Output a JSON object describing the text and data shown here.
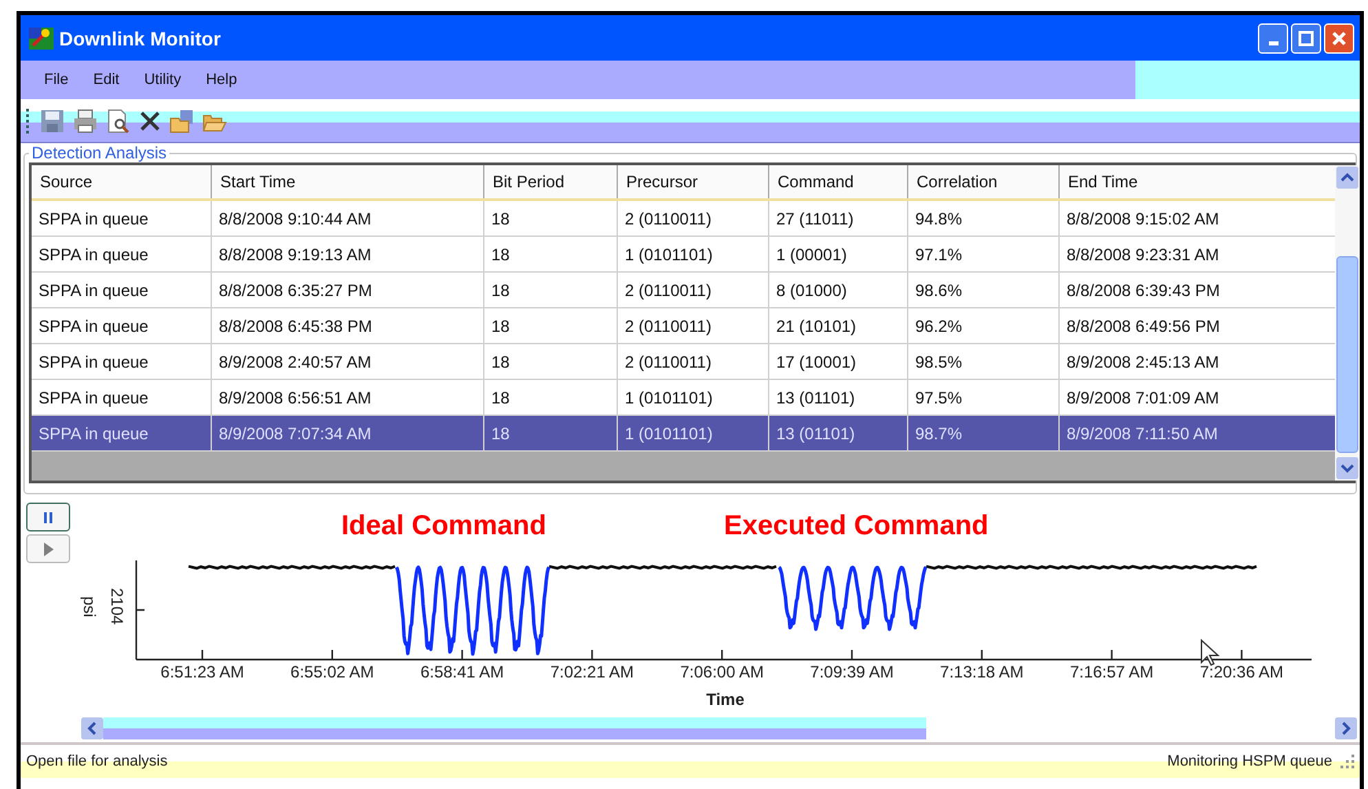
{
  "window": {
    "title": "Downlink Monitor"
  },
  "menu": [
    "File",
    "Edit",
    "Utility",
    "Help"
  ],
  "group": {
    "title": "Detection Analysis"
  },
  "table": {
    "columns": [
      "Source",
      "Start Time",
      "Bit Period",
      "Precursor",
      "Command",
      "Correlation",
      "End Time"
    ],
    "rows": [
      {
        "cells": [
          "SPPA in queue",
          "8/8/2008 9:10:44 AM",
          "18",
          "2 (0110011)",
          "27 (11011)",
          "94.8%",
          "8/8/2008 9:15:02 AM"
        ],
        "selected": false
      },
      {
        "cells": [
          "SPPA in queue",
          "8/8/2008 9:19:13 AM",
          "18",
          "1 (0101101)",
          "1 (00001)",
          "97.1%",
          "8/8/2008 9:23:31 AM"
        ],
        "selected": false
      },
      {
        "cells": [
          "SPPA in queue",
          "8/8/2008 6:35:27 PM",
          "18",
          "2 (0110011)",
          "8 (01000)",
          "98.6%",
          "8/8/2008 6:39:43 PM"
        ],
        "selected": false
      },
      {
        "cells": [
          "SPPA in queue",
          "8/8/2008 6:45:38 PM",
          "18",
          "2 (0110011)",
          "21 (10101)",
          "96.2%",
          "8/8/2008 6:49:56 PM"
        ],
        "selected": false
      },
      {
        "cells": [
          "SPPA in queue",
          "8/9/2008 2:40:57 AM",
          "18",
          "2 (0110011)",
          "17 (10001)",
          "98.5%",
          "8/9/2008 2:45:13 AM"
        ],
        "selected": false
      },
      {
        "cells": [
          "SPPA in queue",
          "8/9/2008 6:56:51 AM",
          "18",
          "1 (0101101)",
          "13 (01101)",
          "97.5%",
          "8/9/2008 7:01:09 AM"
        ],
        "selected": false
      },
      {
        "cells": [
          "SPPA in queue",
          "8/9/2008 7:07:34 AM",
          "18",
          "1 (0101101)",
          "13 (01101)",
          "98.7%",
          "8/9/2008 7:11:50 AM"
        ],
        "selected": true
      }
    ]
  },
  "plot": {
    "annotations": [
      "Ideal Command",
      "Executed Command"
    ],
    "ylabel": "psi",
    "ytick": "2104",
    "xticks": [
      "6:51:23 AM",
      "6:55:02 AM",
      "6:58:41 AM",
      "7:02:21 AM",
      "7:06:00 AM",
      "7:09:39 AM",
      "7:13:18 AM",
      "7:16:57 AM",
      "7:20:36 AM"
    ],
    "xlabel": "Time"
  },
  "status_bar": {
    "left": "Open file for analysis",
    "right": "Monitoring HSPM queue"
  }
}
